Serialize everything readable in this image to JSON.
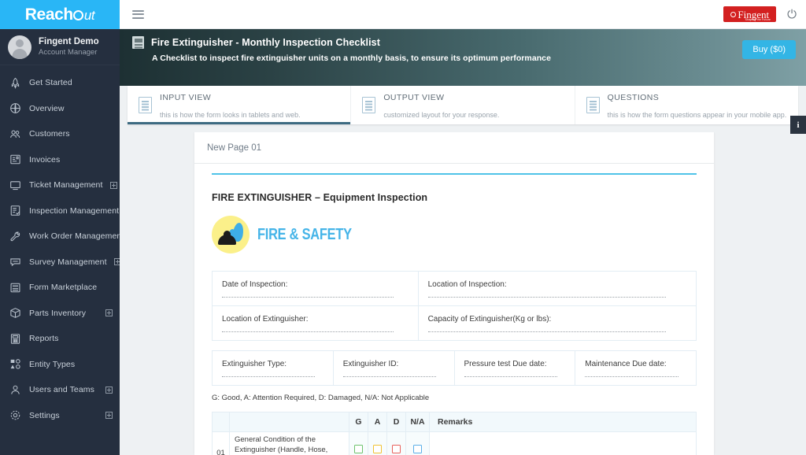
{
  "brand": {
    "name_first": "Reach",
    "name_last": "ut",
    "o_glyph": "o"
  },
  "profile": {
    "name": "Fingent Demo",
    "role": "Account Manager"
  },
  "sidebar": {
    "items": [
      {
        "label": "Get Started",
        "icon": "rocket-icon",
        "expandable": false
      },
      {
        "label": "Overview",
        "icon": "globe-icon",
        "expandable": false
      },
      {
        "label": "Customers",
        "icon": "people-icon",
        "expandable": false
      },
      {
        "label": "Invoices",
        "icon": "invoice-icon",
        "expandable": false
      },
      {
        "label": "Ticket Management",
        "icon": "monitor-icon",
        "expandable": true
      },
      {
        "label": "Inspection Management",
        "icon": "checklist-icon",
        "expandable": true
      },
      {
        "label": "Work Order Management",
        "icon": "wrench-icon",
        "expandable": true
      },
      {
        "label": "Survey Management",
        "icon": "chat-icon",
        "expandable": true
      },
      {
        "label": "Form Marketplace",
        "icon": "form-icon",
        "expandable": false
      },
      {
        "label": "Parts Inventory",
        "icon": "box-icon",
        "expandable": true
      },
      {
        "label": "Reports",
        "icon": "report-icon",
        "expandable": false
      },
      {
        "label": "Entity Types",
        "icon": "shapes-icon",
        "expandable": false
      },
      {
        "label": "Users and Teams",
        "icon": "user-icon",
        "expandable": true
      },
      {
        "label": "Settings",
        "icon": "gear-icon",
        "expandable": true
      }
    ]
  },
  "topbar": {
    "menu_icon": "hamburger-icon",
    "company_logo": "Fingent",
    "company_tagline": "Shaping the Future",
    "power_icon": "power-icon"
  },
  "header": {
    "icon": "form-document-icon",
    "title": "Fire Extinguisher - Monthly Inspection Checklist",
    "subtitle": "A Checklist to inspect fire extinguisher units on a monthly basis, to ensure its optimum performance",
    "buy_label": "Buy ($0)"
  },
  "tabs": [
    {
      "name": "INPUT VIEW",
      "desc": "this is how the form looks in tablets and web.",
      "active": true
    },
    {
      "name": "OUTPUT VIEW",
      "desc": "customized layout for your response.",
      "active": false
    },
    {
      "name": "QUESTIONS",
      "desc": "this is how the form questions appear in your mobile app.",
      "active": false
    }
  ],
  "info_tab": {
    "label": "i"
  },
  "form": {
    "page_tab": "New Page 01",
    "title": "FIRE EXTINGUISHER – Equipment Inspection",
    "logo_text": "FIRE & SAFETY",
    "fields_grid": [
      [
        "Date of Inspection:",
        "Location of Inspection:"
      ],
      [
        "Location of Extinguisher:",
        "Capacity of Extinguisher(Kg or lbs):"
      ]
    ],
    "fields_row": [
      "Extinguisher Type:",
      "Extinguisher ID:",
      "Pressure test Due date:",
      "Maintenance Due date:"
    ],
    "legend": "G: Good, A: Attention Required, D: Damaged, N/A: Not Applicable",
    "table": {
      "headers": [
        "",
        "",
        "G",
        "A",
        "D",
        "N/A",
        "Remarks"
      ],
      "rows": [
        {
          "no": "01",
          "description": "General Condition of the Extinguisher (Handle, Hose,",
          "g": "",
          "a": "",
          "d": "",
          "na": "",
          "remarks": ""
        }
      ]
    }
  },
  "colors": {
    "brand_blue": "#29b6f6",
    "sidebar_bg": "#252f3f",
    "accent_buy": "#33b5e5",
    "rule_blue": "#4fc3e8",
    "check_good": "#6cc26c",
    "check_attention": "#f1c232",
    "check_damaged": "#e8615c",
    "check_na": "#5aaee8"
  }
}
